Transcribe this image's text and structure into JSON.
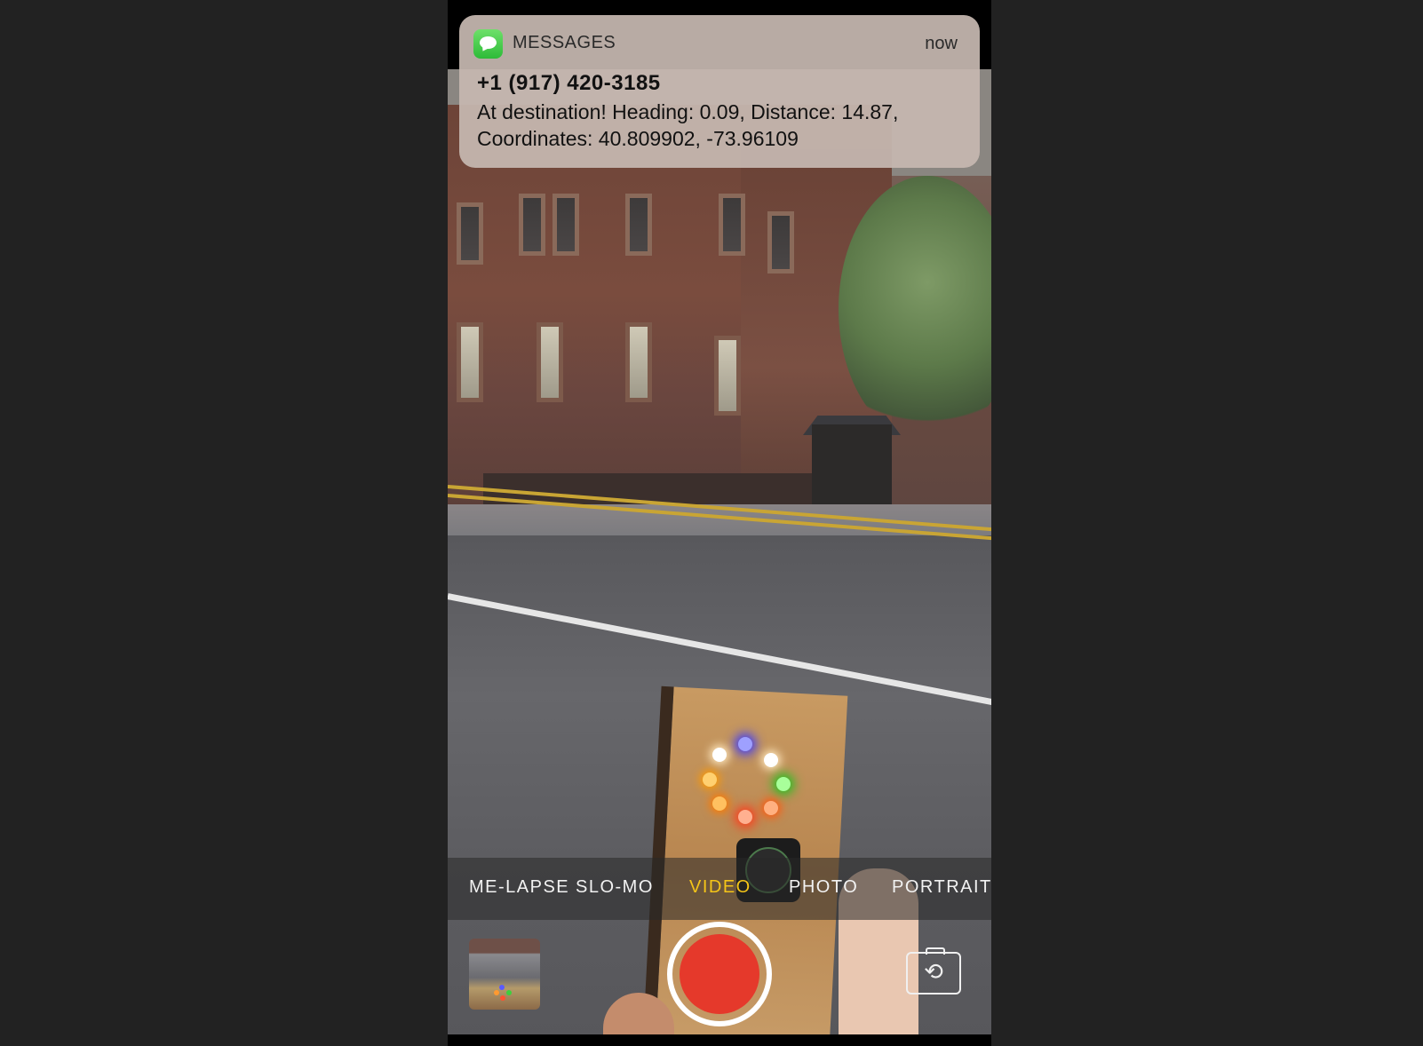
{
  "notification": {
    "app_name": "MESSAGES",
    "time": "now",
    "sender": "+1 (917) 420-3185",
    "body_line1": "At destination! Heading: 0.09, Distance: 14.87,",
    "body_line2": "Coordinates: 40.809902, -73.96109",
    "icon": "messages-app-icon"
  },
  "camera": {
    "modes": [
      "ME-LAPSE",
      "SLO-MO",
      "VIDEO",
      "PHOTO",
      "PORTRAIT"
    ],
    "active_mode": "VIDEO",
    "shutter_icon": "record-button",
    "thumbnail_icon": "last-photo-thumbnail",
    "flip_icon": "camera-flip-icon"
  },
  "colors": {
    "background": "#222222",
    "active_mode": "#f5c518",
    "record_red": "#e5392b",
    "messages_green": "#2dbb38"
  }
}
